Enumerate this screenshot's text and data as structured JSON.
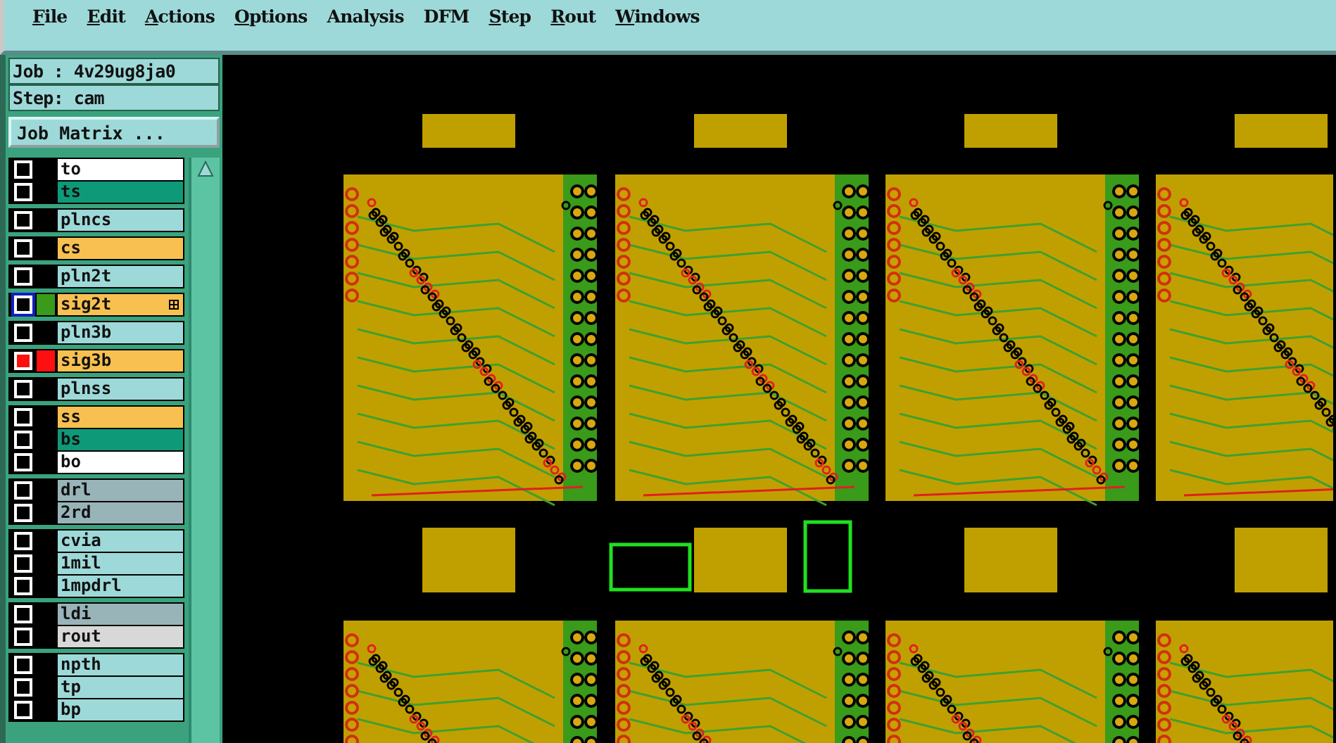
{
  "menu": [
    {
      "label": "File",
      "underline": true
    },
    {
      "label": "Edit",
      "underline": true
    },
    {
      "label": "Actions",
      "underline": true
    },
    {
      "label": "Options",
      "underline": true
    },
    {
      "label": "Analysis",
      "underline": false
    },
    {
      "label": "DFM",
      "underline": false
    },
    {
      "label": "Step",
      "underline": true
    },
    {
      "label": "Rout",
      "underline": true
    },
    {
      "label": "Windows",
      "underline": true
    }
  ],
  "job": "Job : 4v29ug8ja0",
  "step": "Step: cam",
  "matrix_button": "Job Matrix ...",
  "layer_groups": [
    {
      "layers": [
        {
          "name": "to",
          "kind": "legend",
          "affected": false,
          "work": false
        },
        {
          "name": "ts",
          "kind": "mask",
          "affected": false,
          "work": false
        }
      ]
    },
    {
      "layers": [
        {
          "name": "plncs",
          "kind": "plan",
          "affected": false,
          "work": false
        }
      ]
    },
    {
      "layers": [
        {
          "name": "cs",
          "kind": "signal",
          "affected": false,
          "work": false
        }
      ]
    },
    {
      "layers": [
        {
          "name": "pln2t",
          "kind": "plan",
          "affected": false,
          "work": false
        }
      ]
    },
    {
      "layers": [
        {
          "name": "sig2t",
          "kind": "signal",
          "affected": false,
          "work": true,
          "color": "#3a9a1a"
        }
      ]
    },
    {
      "layers": [
        {
          "name": "pln3b",
          "kind": "plan",
          "affected": false,
          "work": false
        }
      ]
    },
    {
      "layers": [
        {
          "name": "sig3b",
          "kind": "signal",
          "affected": true,
          "work": false,
          "color": "#ff1010"
        }
      ]
    },
    {
      "layers": [
        {
          "name": "plnss",
          "kind": "plan",
          "affected": false,
          "work": false
        }
      ]
    },
    {
      "layers": [
        {
          "name": "ss",
          "kind": "signal",
          "affected": false,
          "work": false
        },
        {
          "name": "bs",
          "kind": "mask",
          "affected": false,
          "work": false
        },
        {
          "name": "bo",
          "kind": "legend",
          "affected": false,
          "work": false
        }
      ]
    },
    {
      "layers": [
        {
          "name": "drl",
          "kind": "drill",
          "affected": false,
          "work": false
        },
        {
          "name": "2rd",
          "kind": "drill",
          "affected": false,
          "work": false
        }
      ]
    },
    {
      "layers": [
        {
          "name": "cvia",
          "kind": "plan",
          "affected": false,
          "work": false
        },
        {
          "name": "1mil",
          "kind": "plan",
          "affected": false,
          "work": false
        },
        {
          "name": "1mpdrl",
          "kind": "plan",
          "affected": false,
          "work": false
        }
      ]
    },
    {
      "layers": [
        {
          "name": "ldi",
          "kind": "drill",
          "affected": false,
          "work": false
        },
        {
          "name": "rout",
          "kind": "rout",
          "affected": false,
          "work": false
        }
      ]
    },
    {
      "layers": [
        {
          "name": "npth",
          "kind": "plan",
          "affected": false,
          "work": false
        },
        {
          "name": "tp",
          "kind": "plan",
          "affected": false,
          "work": false
        },
        {
          "name": "bp",
          "kind": "plan",
          "affected": false,
          "work": false
        }
      ]
    }
  ]
}
